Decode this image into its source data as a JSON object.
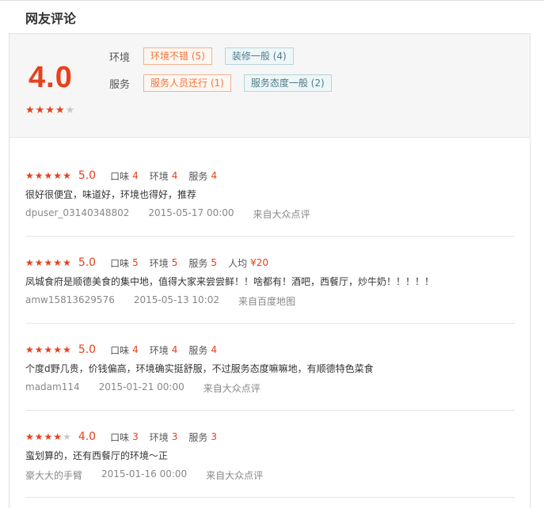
{
  "section_title": "网友评论",
  "summary": {
    "score": "4.0",
    "stars": 4,
    "rows": [
      {
        "label": "环境",
        "tags": [
          {
            "text": "环境不错 (5)",
            "kind": "pos"
          },
          {
            "text": "装修一般 (4)",
            "kind": "neg"
          }
        ]
      },
      {
        "label": "服务",
        "tags": [
          {
            "text": "服务人员还行 (1)",
            "kind": "pos"
          },
          {
            "text": "服务态度一般 (2)",
            "kind": "neg"
          }
        ]
      }
    ]
  },
  "reviews": [
    {
      "stars": 5,
      "score": "5.0",
      "metrics": [
        {
          "label": "口味",
          "value": "4"
        },
        {
          "label": "环境",
          "value": "4"
        },
        {
          "label": "服务",
          "value": "4"
        }
      ],
      "text": "很好很便宜，味道好，环境也得好，推荐",
      "user": "dpuser_03140348802",
      "date": "2015-05-17 00:00",
      "source": "来自大众点评"
    },
    {
      "stars": 5,
      "score": "5.0",
      "metrics": [
        {
          "label": "口味",
          "value": "5"
        },
        {
          "label": "环境",
          "value": "5"
        },
        {
          "label": "服务",
          "value": "5"
        },
        {
          "label": "人均",
          "value": "¥20"
        }
      ],
      "text": "凤城食府是顺德美食的集中地，值得大家来尝尝鲜！！啥都有！酒吧，西餐厅，炒牛奶！！！！！",
      "user": "amw15813629576",
      "date": "2015-05-13 10:02",
      "source": "来自百度地图"
    },
    {
      "stars": 5,
      "score": "5.0",
      "metrics": [
        {
          "label": "口味",
          "value": "4"
        },
        {
          "label": "环境",
          "value": "4"
        },
        {
          "label": "服务",
          "value": "4"
        }
      ],
      "text": "个度d野几贵，价钱偏高，环境确实挺舒服，不过服务态度嘛嘛地，有顺德特色菜食",
      "user": "madam114",
      "date": "2015-01-21 00:00",
      "source": "来自大众点评"
    },
    {
      "stars": 4,
      "score": "4.0",
      "metrics": [
        {
          "label": "口味",
          "value": "3"
        },
        {
          "label": "环境",
          "value": "3"
        },
        {
          "label": "服务",
          "value": "3"
        }
      ],
      "text": "蛮划算的，还有西餐厅的环境～正",
      "user": "豪大大的手臂",
      "date": "2015-01-16 00:00",
      "source": "来自大众点评"
    }
  ]
}
